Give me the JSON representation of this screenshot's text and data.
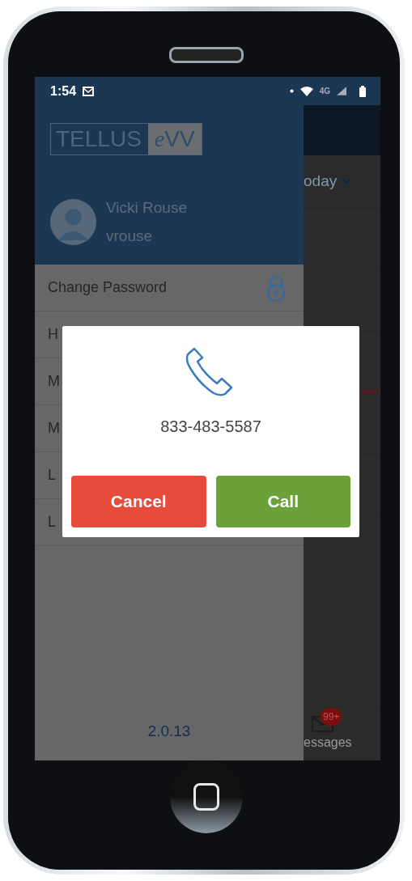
{
  "status_bar": {
    "time": "1:54",
    "network": "4G"
  },
  "drawer": {
    "logo": {
      "left": "TELLUS",
      "letter": "e",
      "right": "VV"
    },
    "user": {
      "name": "Vicki Rouse",
      "username": "vrouse"
    },
    "menu_items": [
      {
        "label": "Change Password"
      },
      {
        "label": "H"
      },
      {
        "label": "M"
      },
      {
        "label": "M"
      },
      {
        "label": "L"
      },
      {
        "label": "L"
      }
    ],
    "version": "2.0.13"
  },
  "background": {
    "filter": "oday",
    "nav_label": "essages",
    "badge": "99+"
  },
  "dialog": {
    "number": "833-483-5587",
    "buttons": [
      {
        "label": "Cancel",
        "kind": "cancel"
      },
      {
        "label": "Call",
        "kind": "call"
      }
    ]
  }
}
